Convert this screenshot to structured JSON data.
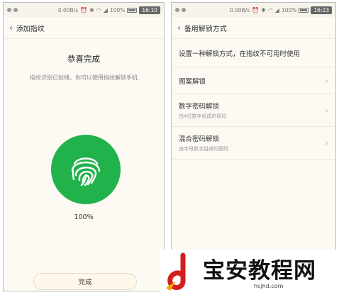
{
  "left_screen": {
    "status": {
      "speed": "0.00B/s",
      "battery": "100%",
      "time": "16:10"
    },
    "title": "添加指纹",
    "congrats_title": "恭喜完成",
    "congrats_sub": "指纹识别已就绪，你可以使用指纹解锁手机",
    "progress": "100%",
    "done_label": "完成"
  },
  "right_screen": {
    "status": {
      "speed": "0.00B/s",
      "battery": "100%",
      "time": "16:23"
    },
    "title": "备用解锁方式",
    "instruction": "设置一种解锁方式，在指纹不可用时使用",
    "options": [
      {
        "title": "图案解锁",
        "desc": ""
      },
      {
        "title": "数字密码解锁",
        "desc": "由4位数字组成的密码"
      },
      {
        "title": "混合密码解锁",
        "desc": "由字母数字组成的密码"
      }
    ]
  },
  "watermark": {
    "text": "宝安教程网",
    "url": "hcjhd.com"
  },
  "colors": {
    "accent": "#22b24c",
    "background": "#fcfaf3"
  }
}
